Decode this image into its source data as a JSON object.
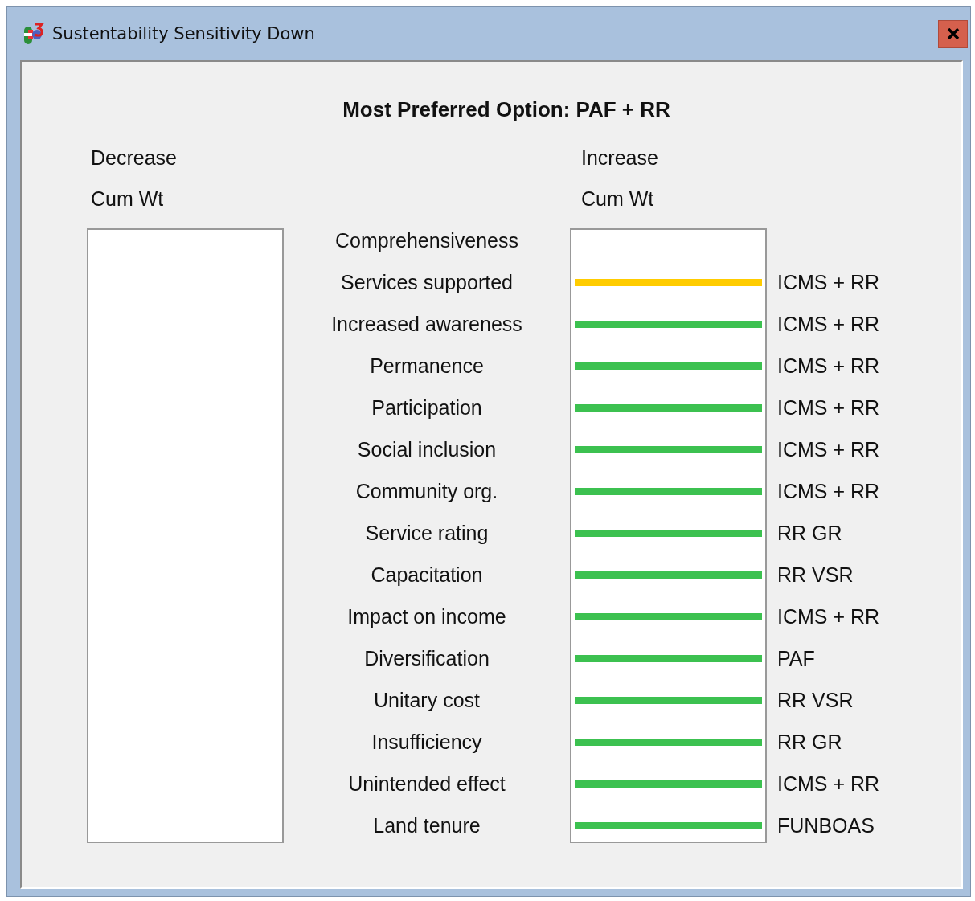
{
  "window": {
    "title": "Sustentability Sensitivity Down"
  },
  "heading": "Most Preferred Option: PAF + RR",
  "left_header": [
    "Decrease",
    "Cum Wt"
  ],
  "right_header": [
    "Increase",
    "Cum Wt"
  ],
  "rows": [
    {
      "criterion": "Comprehensiveness"
    },
    {
      "criterion": "Services supported",
      "color": "#ffcc00",
      "option": "ICMS + RR"
    },
    {
      "criterion": "Increased awareness",
      "color": "#3cc150",
      "option": "ICMS + RR"
    },
    {
      "criterion": "Permanence",
      "color": "#3cc150",
      "option": "ICMS + RR"
    },
    {
      "criterion": "Participation",
      "color": "#3cc150",
      "option": "ICMS + RR"
    },
    {
      "criterion": "Social inclusion",
      "color": "#3cc150",
      "option": "ICMS + RR"
    },
    {
      "criterion": "Community org.",
      "color": "#3cc150",
      "option": "ICMS + RR"
    },
    {
      "criterion": "Service rating",
      "color": "#3cc150",
      "option": "RR GR"
    },
    {
      "criterion": "Capacitation",
      "color": "#3cc150",
      "option": "RR VSR"
    },
    {
      "criterion": "Impact on income",
      "color": "#3cc150",
      "option": "ICMS + RR"
    },
    {
      "criterion": "Diversification",
      "color": "#3cc150",
      "option": "PAF"
    },
    {
      "criterion": "Unitary cost",
      "color": "#3cc150",
      "option": "RR VSR"
    },
    {
      "criterion": "Insufficiency",
      "color": "#3cc150",
      "option": "RR GR"
    },
    {
      "criterion": "Unintended effect",
      "color": "#3cc150",
      "option": "ICMS + RR"
    },
    {
      "criterion": "Land tenure",
      "color": "#3cc150",
      "option": "FUNBOAS"
    }
  ]
}
